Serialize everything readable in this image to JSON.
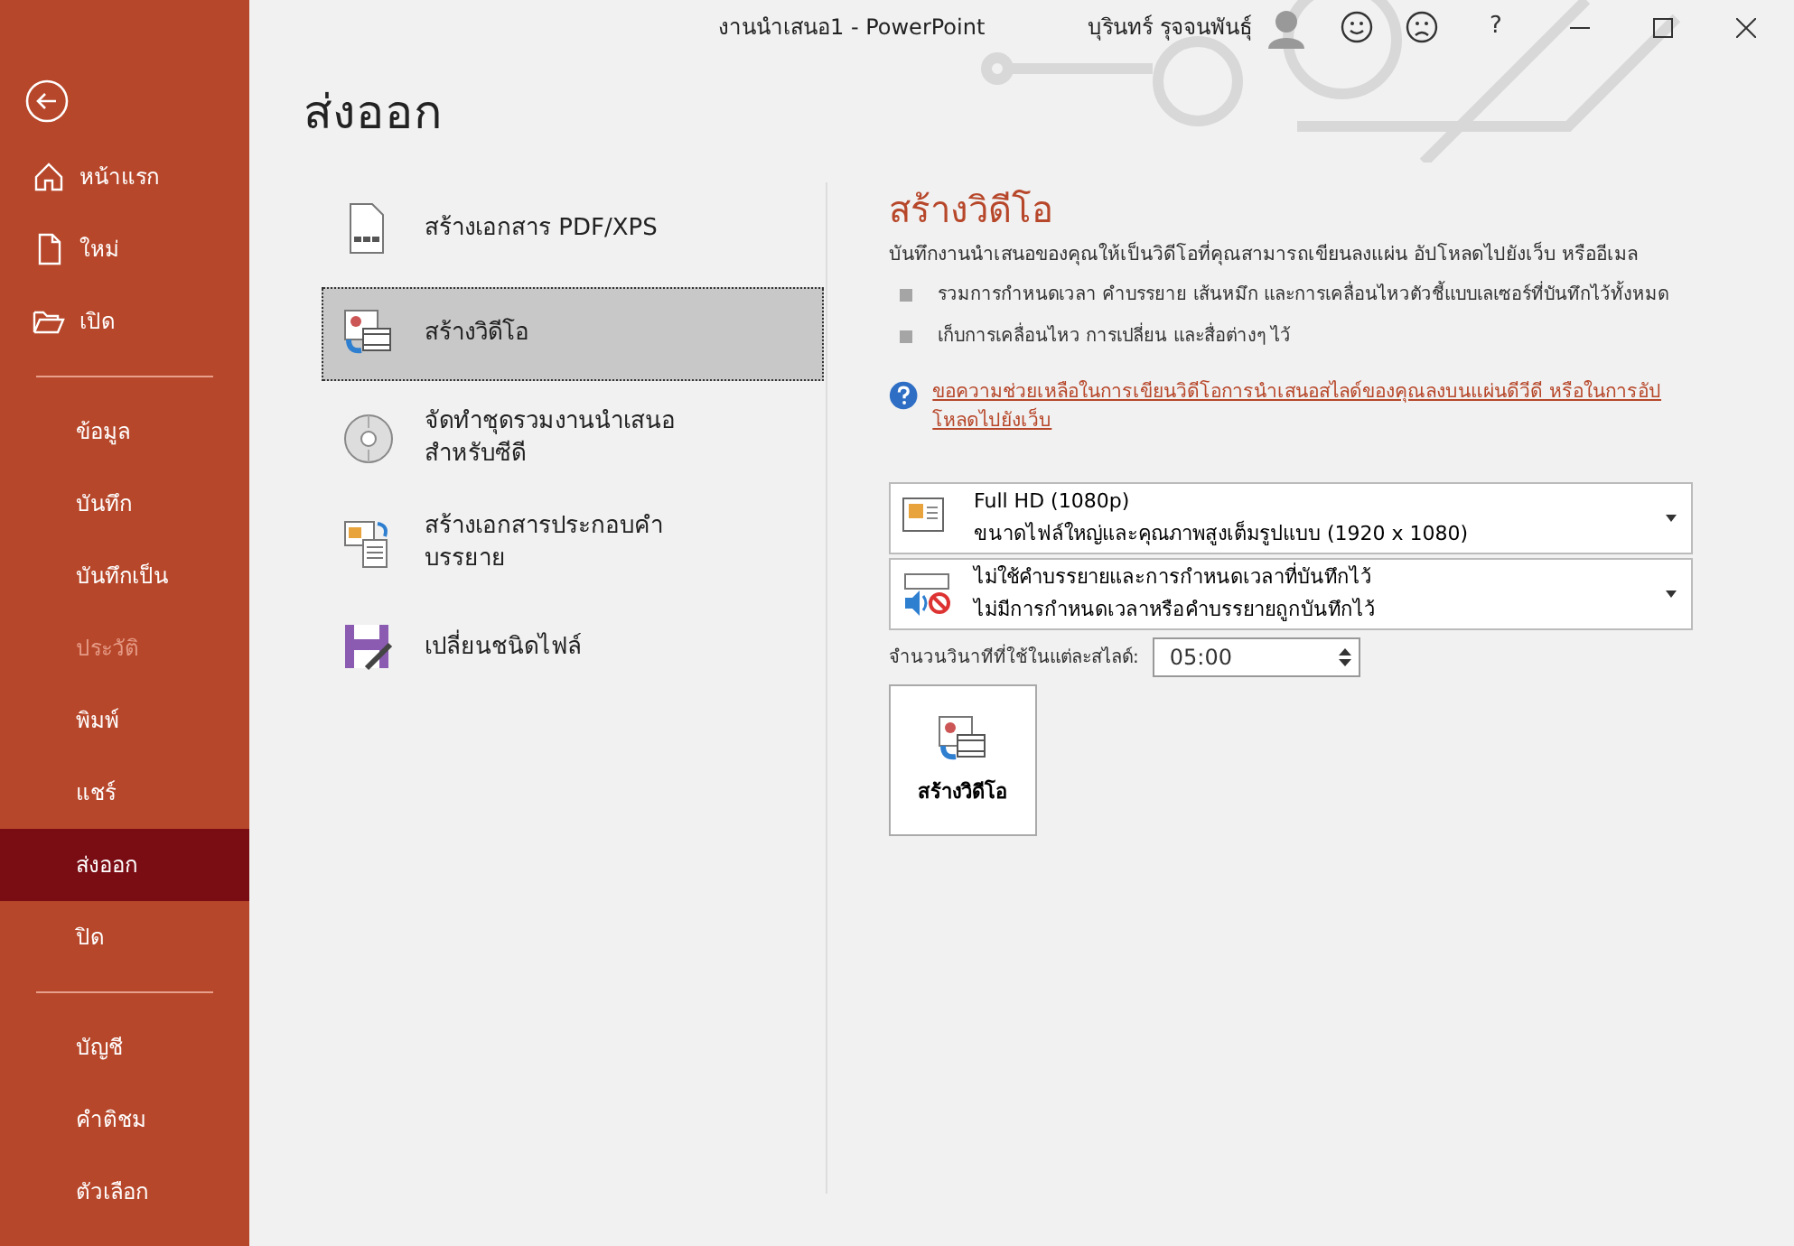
{
  "window": {
    "title": "งานนำเสนอ1  -  PowerPoint",
    "user": "บุรินทร์ รุจจนพันธุ์",
    "help": "?"
  },
  "sidebar": {
    "groups": [
      [
        {
          "label": "หน้าแรก",
          "selected": false,
          "disabled": false
        },
        {
          "label": "ใหม่",
          "selected": false,
          "disabled": false
        },
        {
          "label": "เปิด",
          "selected": false,
          "disabled": false
        }
      ],
      [
        {
          "label": "ข้อมูล",
          "selected": false,
          "disabled": false
        },
        {
          "label": "บันทึก",
          "selected": false,
          "disabled": false
        },
        {
          "label": "บันทึกเป็น",
          "selected": false,
          "disabled": false
        },
        {
          "label": "ประวัติ",
          "selected": false,
          "disabled": true
        },
        {
          "label": "พิมพ์",
          "selected": false,
          "disabled": false
        },
        {
          "label": "แชร์",
          "selected": false,
          "disabled": false
        },
        {
          "label": "ส่งออก",
          "selected": true,
          "disabled": false
        },
        {
          "label": "ปิด",
          "selected": false,
          "disabled": false
        }
      ],
      [
        {
          "label": "บัญชี",
          "selected": false,
          "disabled": false
        },
        {
          "label": "คำติชม",
          "selected": false,
          "disabled": false
        },
        {
          "label": "ตัวเลือก",
          "selected": false,
          "disabled": false
        }
      ]
    ]
  },
  "page_title": "ส่งออก",
  "export_options": [
    {
      "kind": "pdf",
      "label": "สร้างเอกสาร PDF/XPS",
      "selected": false
    },
    {
      "kind": "video",
      "label": "สร้างวิดีโอ",
      "selected": true
    },
    {
      "kind": "cd",
      "label": "จัดทำชุดรวมงานนำเสนอ\nสำหรับซีดี",
      "selected": false
    },
    {
      "kind": "handout",
      "label": "สร้างเอกสารประกอบคำ\nบรรยาย",
      "selected": false
    },
    {
      "kind": "filetype",
      "label": "เปลี่ยนชนิดไฟล์",
      "selected": false
    }
  ],
  "detail": {
    "title": "สร้างวิดีโอ",
    "description": "บันทึกงานนำเสนอของคุณให้เป็นวิดีโอที่คุณสามารถเขียนลงแผ่น อัปโหลดไปยังเว็บ หรืออีเมล",
    "bullets": [
      "รวมการกำหนดเวลา คำบรรยาย เส้นหมึก และการเคลื่อนไหวตัวชี้แบบเลเซอร์ที่บันทึกไว้ทั้งหมด",
      "เก็บการเคลื่อนไหว การเปลี่ยน และสื่อต่างๆ ไว้"
    ],
    "help_link": "ขอความช่วยเหลือในการเขียนวิดีโอการนำเสนอสไลด์ของคุณลงบนแผ่นดีวีดี หรือในการอัปโหลดไปยังเว็บ",
    "dropdowns": [
      {
        "kind": "quality",
        "title": "Full HD (1080p)",
        "subtitle": "ขนาดไฟล์ใหญ่และคุณภาพสูงเต็มรูปแบบ (1920 x 1080)"
      },
      {
        "kind": "narration",
        "title": "ไม่ใช้คำบรรยายและการกำหนดเวลาที่บันทึกไว้",
        "subtitle": "ไม่มีการกำหนดเวลาหรือคำบรรยายถูกบันทึกไว้"
      }
    ],
    "seconds": {
      "label": "จำนวนวินาทีที่ใช้ในแต่ละสไลด์:",
      "value": "05:00"
    },
    "create_button": "สร้างวิดีโอ"
  }
}
